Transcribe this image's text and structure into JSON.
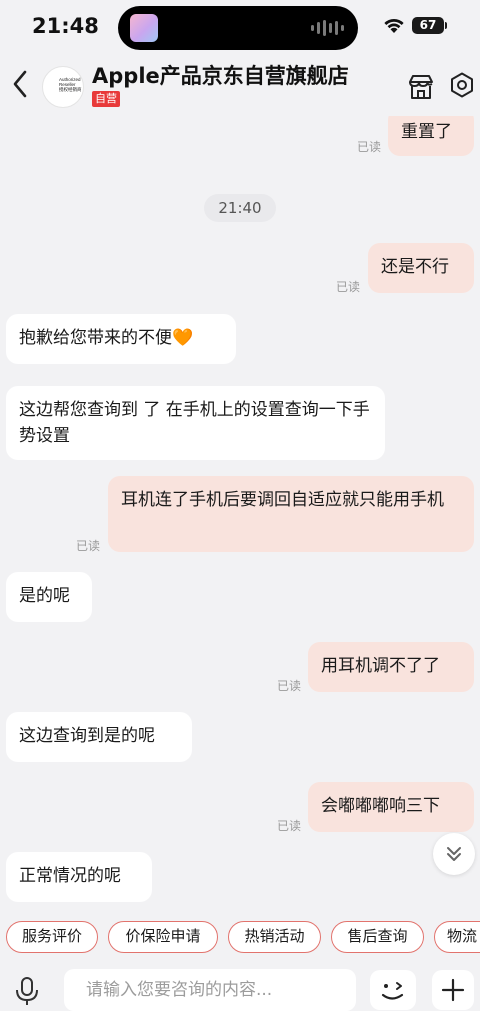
{
  "status_bar": {
    "time": "21:48",
    "battery": "67"
  },
  "header": {
    "store_name": "Apple产品京东自营旗舰店",
    "badge": "自营",
    "logo_caption": "Authorized\nReseller\n授权经销商"
  },
  "chat": {
    "time_divider": "21:40",
    "read_label": "已读",
    "messages": [
      {
        "from": "me",
        "text": "重置了"
      },
      {
        "from": "me",
        "text": "还是不行"
      },
      {
        "from": "agent",
        "text": "抱歉给您带来的不便🧡"
      },
      {
        "from": "agent",
        "text": "这边帮您查询到 了      在手机上的设置查询一下手势设置"
      },
      {
        "from": "me",
        "text": "耳机连了手机后要调回自适应就只能用手机"
      },
      {
        "from": "agent",
        "text": "是的呢"
      },
      {
        "from": "me",
        "text": "用耳机调不了了"
      },
      {
        "from": "agent",
        "text": "这边查询到是的呢"
      },
      {
        "from": "me",
        "text": "会嘟嘟嘟响三下"
      },
      {
        "from": "agent",
        "text": "正常情况的呢"
      }
    ]
  },
  "quick_actions": [
    "服务评价",
    "价保险申请",
    "热销活动",
    "售后查询",
    "物流"
  ],
  "input": {
    "placeholder": "请输入您要咨询的内容..."
  },
  "colors": {
    "outgoing_bubble": "#f9e3dd",
    "chip_border": "#e2736d",
    "badge": "#e83a3a"
  }
}
